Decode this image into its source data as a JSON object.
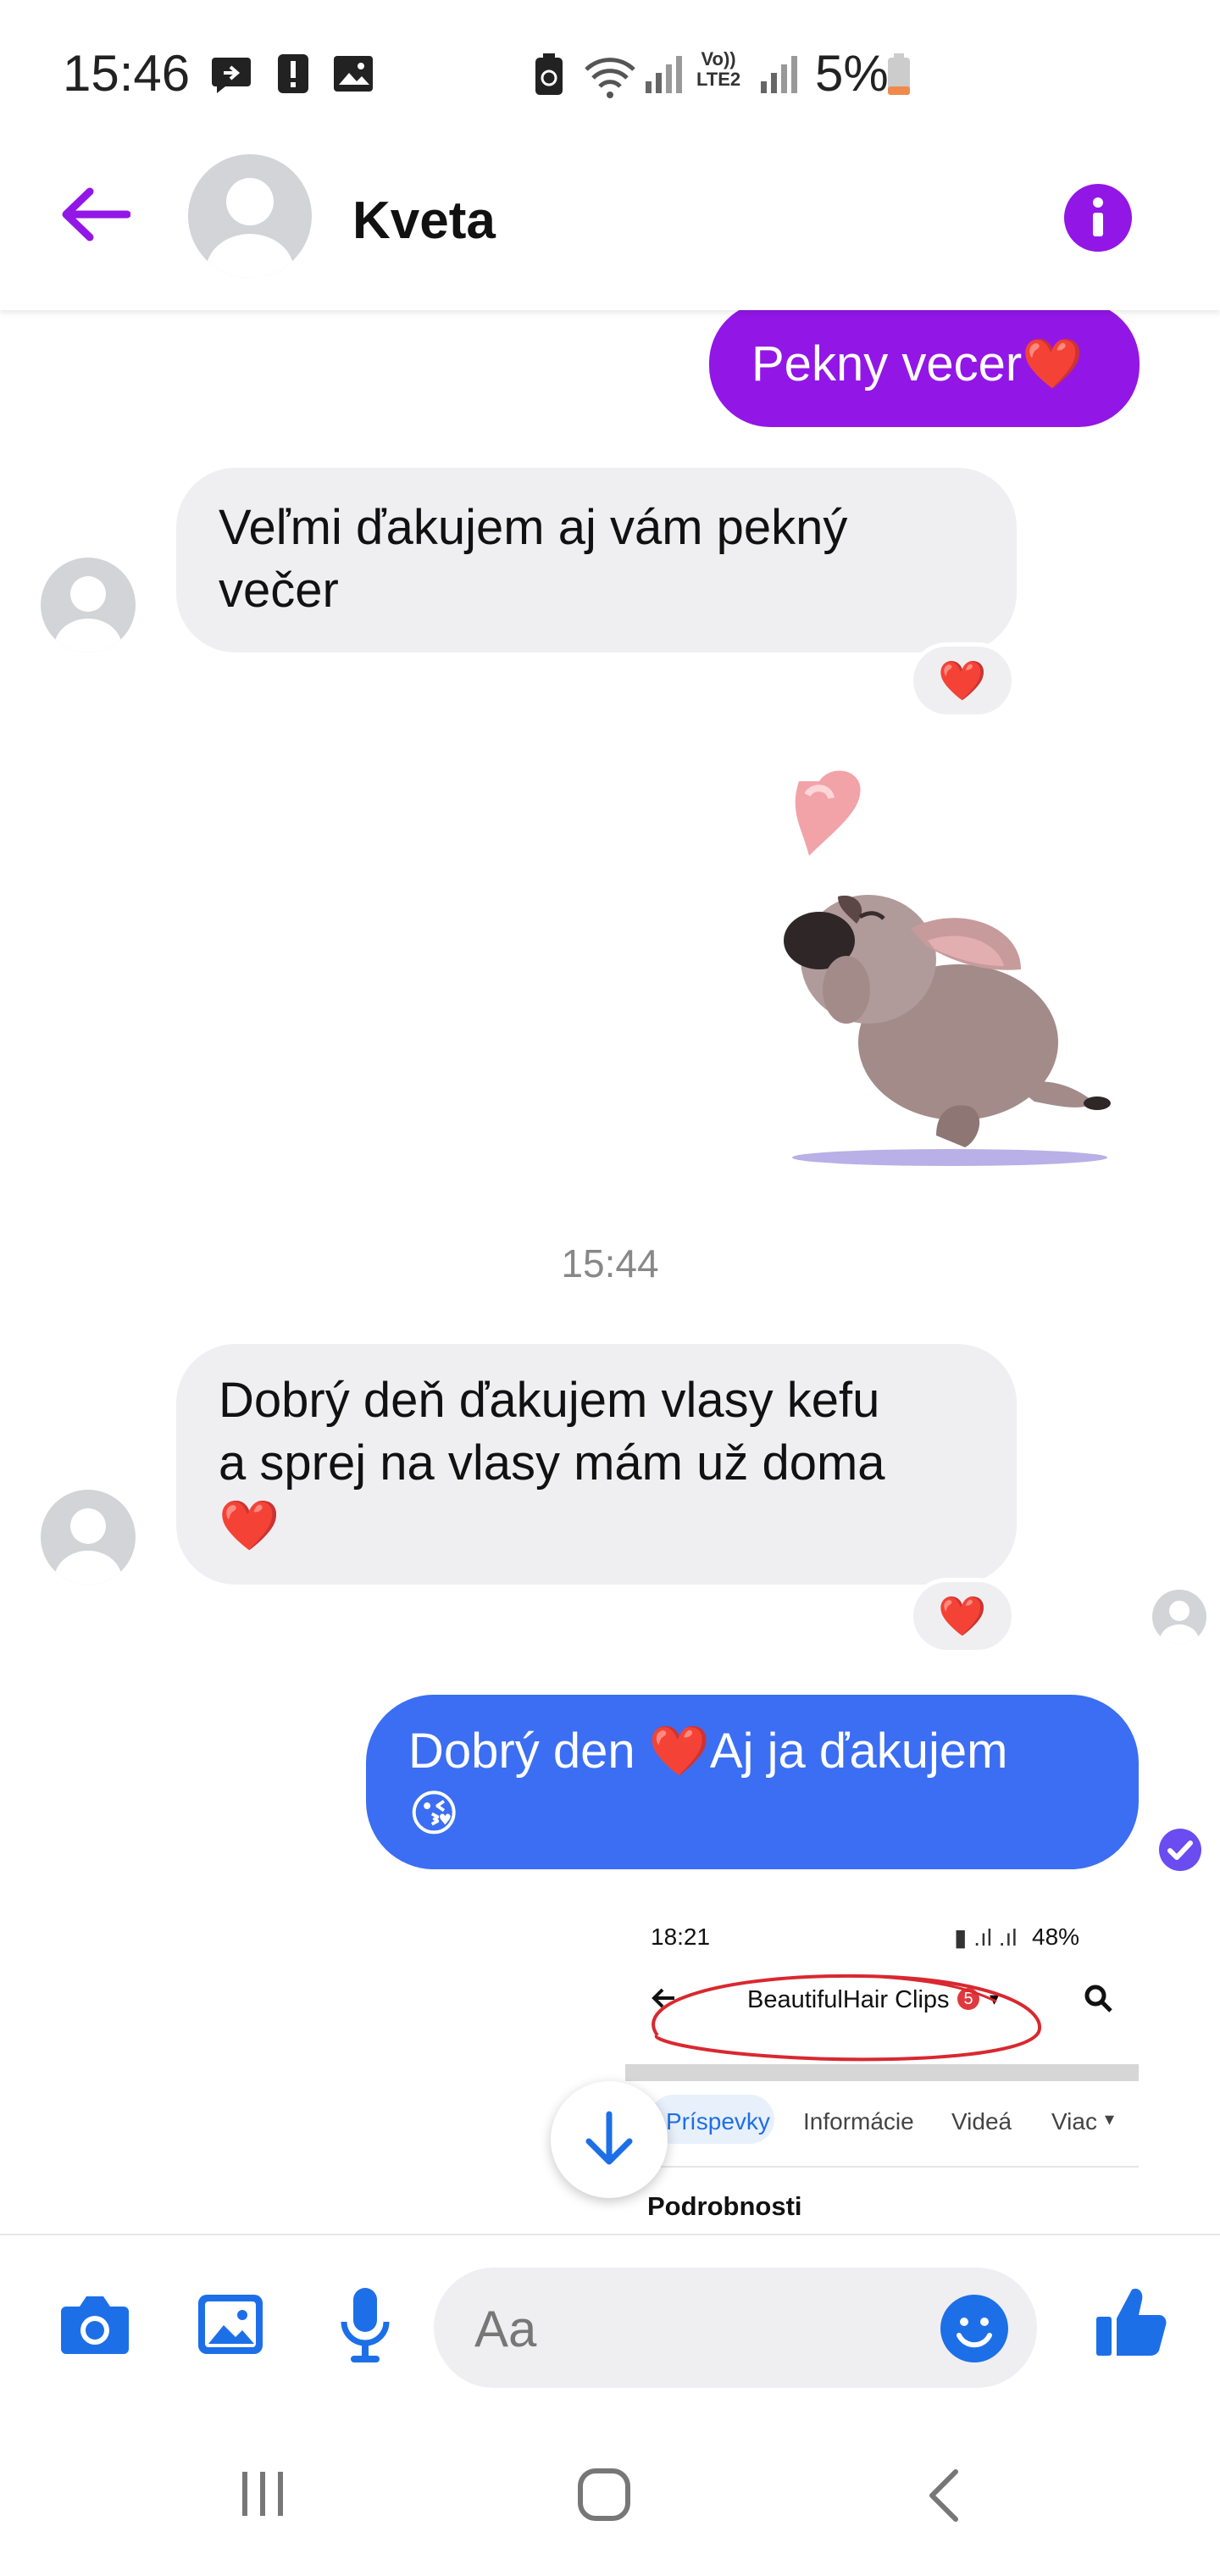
{
  "status_bar": {
    "time": "15:46",
    "network_label_top": "Vo))",
    "network_label_bottom": "LTE2",
    "battery_percent": "5%"
  },
  "header": {
    "contact_name": "Kveta"
  },
  "messages": {
    "out_1": "Pekny vecer❤️",
    "in_1_line1": "Veľmi ďakujem aj vám pekný",
    "in_1_line2": "večer",
    "in_1_reaction": "❤️",
    "timestamp": "15:44",
    "in_2_line1": "Dobrý deň ďakujem vlasy kefu",
    "in_2_line2": "a sprej na vlasy mám už doma",
    "in_2_line3": "❤️",
    "in_2_reaction": "❤️",
    "out_2_line1": "Dobrý den ❤️Aj ja ďakujem",
    "out_2_line2": "😘"
  },
  "shared_screenshot": {
    "time": "18:21",
    "battery": "48%",
    "page_title": "BeautifulHair Clips",
    "badge": "5",
    "tabs": [
      "Príspevky",
      "Informácie",
      "Videá",
      "Viac"
    ],
    "section": "Podrobnosti"
  },
  "composer": {
    "placeholder": "Aa"
  },
  "colors": {
    "accent_purple": "#9217e6",
    "messenger_blue": "#3b6ef3",
    "icon_blue": "#1d6fe8",
    "bubble_gray": "#efeff1"
  }
}
